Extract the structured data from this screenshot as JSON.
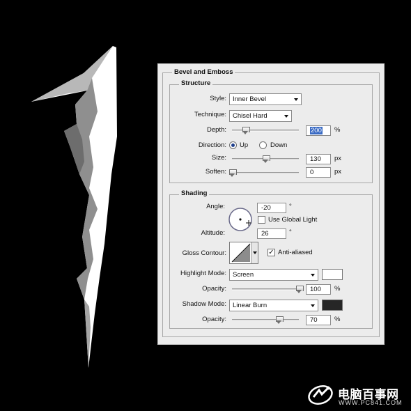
{
  "colors": {
    "background": "#000000",
    "panel": "#ececec",
    "highlight_swatch": "#ffffff",
    "shadow_swatch": "#262626",
    "selection": "#3a6bc4"
  },
  "panel": {
    "title": "Bevel and Emboss",
    "structure": {
      "title": "Structure",
      "style": {
        "label": "Style:",
        "value": "Inner Bevel"
      },
      "technique": {
        "label": "Technique:",
        "value": "Chisel Hard"
      },
      "depth": {
        "label": "Depth:",
        "value": "200",
        "unit": "%",
        "slider_fraction": 0.2
      },
      "direction": {
        "label": "Direction:",
        "up_label": "Up",
        "down_label": "Down",
        "selected": "Up"
      },
      "size": {
        "label": "Size:",
        "value": "130",
        "unit": "px",
        "slider_fraction": 0.5
      },
      "soften": {
        "label": "Soften:",
        "value": "0",
        "unit": "px",
        "slider_fraction": 0.0
      }
    },
    "shading": {
      "title": "Shading",
      "angle": {
        "label": "Angle:",
        "value": "-20",
        "unit": "°"
      },
      "use_global_light": {
        "label": "Use Global Light",
        "checked": false
      },
      "altitude": {
        "label": "Altitude:",
        "value": "26",
        "unit": "°"
      },
      "gloss_contour": {
        "label": "Gloss Contour:"
      },
      "anti_aliased": {
        "label": "Anti-aliased",
        "checked": true,
        "mark": "✓"
      },
      "highlight_mode": {
        "label": "Highlight Mode:",
        "value": "Screen"
      },
      "highlight_opacity": {
        "label": "Opacity:",
        "value": "100",
        "unit": "%",
        "slider_fraction": 1.0
      },
      "shadow_mode": {
        "label": "Shadow Mode:",
        "value": "Linear Burn"
      },
      "shadow_opacity": {
        "label": "Opacity:",
        "value": "70",
        "unit": "%",
        "slider_fraction": 0.7
      }
    }
  },
  "watermark": {
    "title": "电脑百事网",
    "url": "WWW.PC841.COM"
  }
}
